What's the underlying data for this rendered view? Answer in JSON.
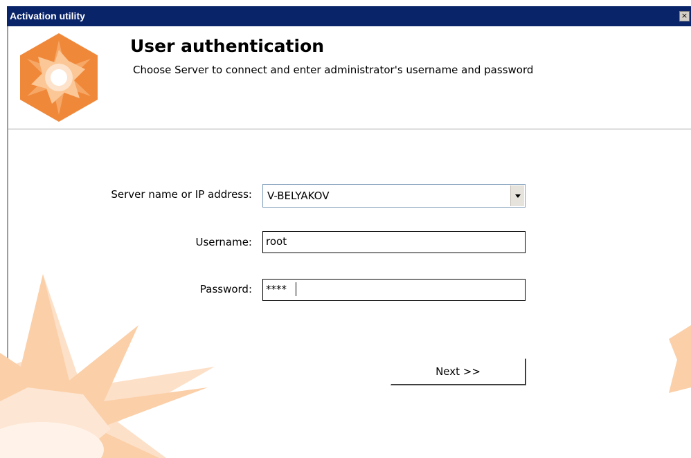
{
  "window": {
    "title": "Activation utility",
    "close_glyph": "×"
  },
  "header": {
    "title": "User authentication",
    "subtitle": "Choose Server to connect and enter administrator's username and password"
  },
  "form": {
    "server": {
      "label": "Server name or IP address:",
      "value": "V-BELYAKOV"
    },
    "username": {
      "label": "Username:",
      "value": "root"
    },
    "password": {
      "label": "Password:",
      "value": "****"
    }
  },
  "buttons": {
    "next_label": "Next >>"
  },
  "icons": {
    "logo": "star-hexagon-logo",
    "dropdown": "chevron-down-icon",
    "close": "close-icon"
  },
  "colors": {
    "titlebar": "#0a246a",
    "logo_orange": "#f0883a",
    "watermark_orange": "#f9c9a2"
  }
}
